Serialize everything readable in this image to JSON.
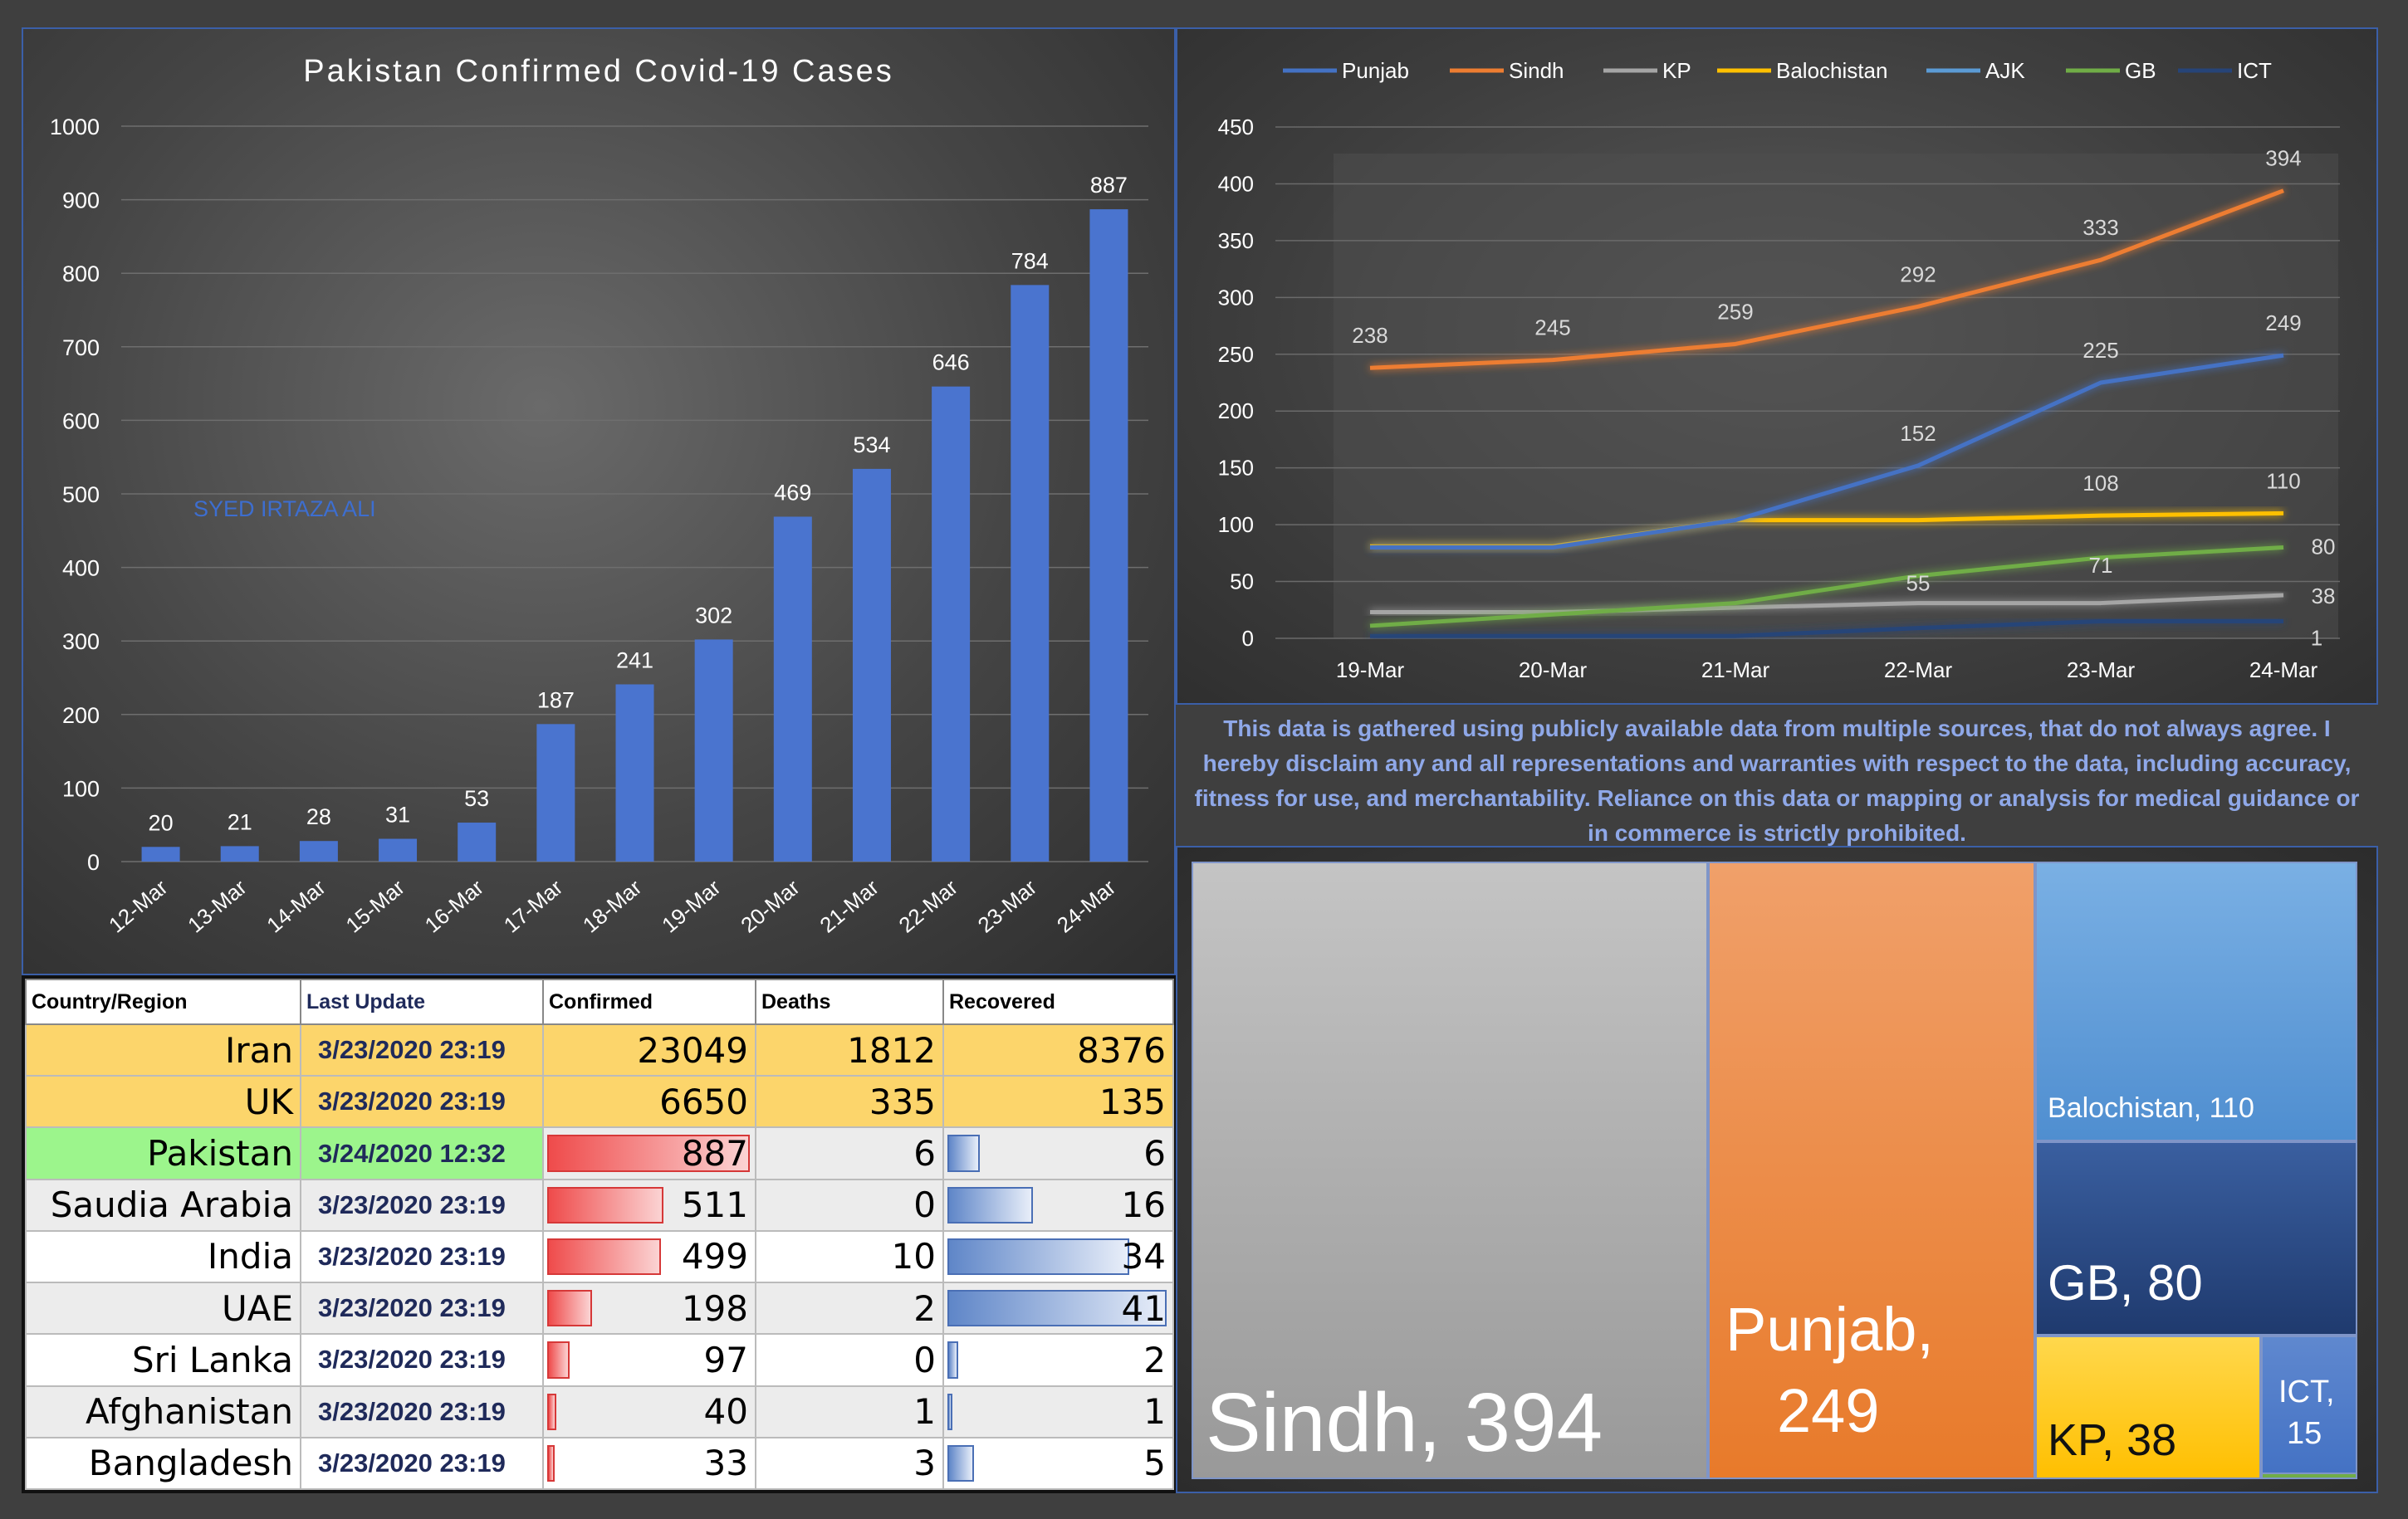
{
  "colors": {
    "bar_fill": "#4a74cf",
    "Punjab": "#4472c4",
    "Sindh": "#ed7d31",
    "KP": "#a5a5a5",
    "Balochistan": "#ffc000",
    "AJK": "#5b9bd5",
    "GB": "#70ad47",
    "ICT": "#264478",
    "row_highlight": "#fcd56b",
    "row_pakistan": "#9cf58c"
  },
  "chart_data": [
    {
      "type": "bar",
      "title": "Pakistan Confirmed Covid-19 Cases",
      "watermark": "SYED IRTAZA ALI",
      "categories": [
        "12-Mar",
        "13-Mar",
        "14-Mar",
        "15-Mar",
        "16-Mar",
        "17-Mar",
        "18-Mar",
        "19-Mar",
        "20-Mar",
        "21-Mar",
        "22-Mar",
        "23-Mar",
        "24-Mar"
      ],
      "values": [
        20,
        21,
        28,
        31,
        53,
        187,
        241,
        302,
        469,
        534,
        646,
        784,
        887
      ],
      "ylim": [
        0,
        1000
      ],
      "yticks": [
        0,
        100,
        200,
        300,
        400,
        500,
        600,
        700,
        800,
        900,
        1000
      ],
      "grid": true
    },
    {
      "type": "line",
      "categories": [
        "19-Mar",
        "20-Mar",
        "21-Mar",
        "22-Mar",
        "23-Mar",
        "24-Mar"
      ],
      "ylim": [
        0,
        450
      ],
      "yticks": [
        0,
        50,
        100,
        150,
        200,
        250,
        300,
        350,
        400,
        450
      ],
      "legend_position": "top",
      "grid": true,
      "series": [
        {
          "name": "Punjab",
          "values": [
            80,
            80,
            104,
            152,
            225,
            249
          ],
          "labels": [
            null,
            null,
            null,
            "152",
            "225",
            "249"
          ]
        },
        {
          "name": "Sindh",
          "values": [
            238,
            245,
            259,
            292,
            333,
            394
          ],
          "labels": [
            "238",
            "245",
            "259",
            "292",
            "333",
            "394"
          ]
        },
        {
          "name": "KP",
          "values": [
            23,
            23,
            27,
            31,
            31,
            38
          ],
          "labels": [
            null,
            null,
            null,
            null,
            null,
            "38"
          ]
        },
        {
          "name": "Balochistan",
          "values": [
            81,
            81,
            104,
            104,
            108,
            110
          ],
          "labels": [
            null,
            null,
            null,
            null,
            "108",
            "110"
          ]
        },
        {
          "name": "AJK",
          "values": [
            1,
            1,
            1,
            1,
            1,
            1
          ],
          "labels": [
            null,
            null,
            null,
            null,
            null,
            "1"
          ]
        },
        {
          "name": "GB",
          "values": [
            11,
            21,
            31,
            55,
            71,
            80
          ],
          "labels": [
            null,
            null,
            null,
            "55",
            "71",
            "80"
          ]
        },
        {
          "name": "ICT",
          "values": [
            2,
            2,
            2,
            9,
            15,
            15
          ],
          "labels": [
            null,
            null,
            null,
            null,
            null,
            null
          ]
        }
      ]
    },
    {
      "type": "treemap",
      "items": [
        {
          "name": "Sindh",
          "value": 394,
          "label": "Sindh, 394"
        },
        {
          "name": "Punjab",
          "value": 249,
          "label_line1": "Punjab,",
          "label_line2": "249"
        },
        {
          "name": "Balochistan",
          "value": 110,
          "label": "Balochistan, 110"
        },
        {
          "name": "GB",
          "value": 80,
          "label": "GB, 80"
        },
        {
          "name": "KP",
          "value": 38,
          "label": "KP, 38"
        },
        {
          "name": "ICT",
          "value": 15,
          "label_line1": "ICT,",
          "label_line2": "15"
        },
        {
          "name": "AJK",
          "value": 1
        }
      ]
    }
  ],
  "disclaimer": "This data is gathered using publicly available data from multiple sources, that do not always agree. I hereby disclaim any and all representations and warranties with respect to the data, including accuracy, fitness for use, and merchantability. Reliance on this data or mapping or analysis for medical guidance or in commerce is strictly prohibited.",
  "table": {
    "headers": [
      "Country/Region",
      "Last Update",
      "Confirmed",
      "Deaths",
      "Recovered"
    ],
    "rows": [
      {
        "country": "Iran",
        "last_update": "3/23/2020 23:19",
        "confirmed": "23049",
        "deaths": "1812",
        "recovered": "8376",
        "style": "highlight"
      },
      {
        "country": "UK",
        "last_update": "3/23/2020 23:19",
        "confirmed": "6650",
        "deaths": "335",
        "recovered": "135",
        "style": "highlight"
      },
      {
        "country": "Pakistan",
        "last_update": "3/24/2020 12:32",
        "confirmed": "887",
        "deaths": "6",
        "recovered": "6",
        "style": "pakistan",
        "confirmed_bar": 1.0,
        "recovered_bar": 0.146
      },
      {
        "country": "Saudia Arabia",
        "last_update": "3/23/2020 23:19",
        "confirmed": "511",
        "deaths": "0",
        "recovered": "16",
        "style": "gray",
        "confirmed_bar": 0.576,
        "recovered_bar": 0.39
      },
      {
        "country": "India",
        "last_update": "3/23/2020 23:19",
        "confirmed": "499",
        "deaths": "10",
        "recovered": "34",
        "style": "white",
        "confirmed_bar": 0.563,
        "recovered_bar": 0.83
      },
      {
        "country": "UAE",
        "last_update": "3/23/2020 23:19",
        "confirmed": "198",
        "deaths": "2",
        "recovered": "41",
        "style": "gray",
        "confirmed_bar": 0.223,
        "recovered_bar": 1.0
      },
      {
        "country": "Sri Lanka",
        "last_update": "3/23/2020 23:19",
        "confirmed": "97",
        "deaths": "0",
        "recovered": "2",
        "style": "white",
        "confirmed_bar": 0.109,
        "recovered_bar": 0.049
      },
      {
        "country": "Afghanistan",
        "last_update": "3/23/2020 23:19",
        "confirmed": "40",
        "deaths": "1",
        "recovered": "1",
        "style": "gray",
        "confirmed_bar": 0.045,
        "recovered_bar": 0.024
      },
      {
        "country": "Bangladesh",
        "last_update": "3/23/2020 23:19",
        "confirmed": "33",
        "deaths": "3",
        "recovered": "5",
        "style": "white",
        "confirmed_bar": 0.037,
        "recovered_bar": 0.122
      }
    ]
  }
}
